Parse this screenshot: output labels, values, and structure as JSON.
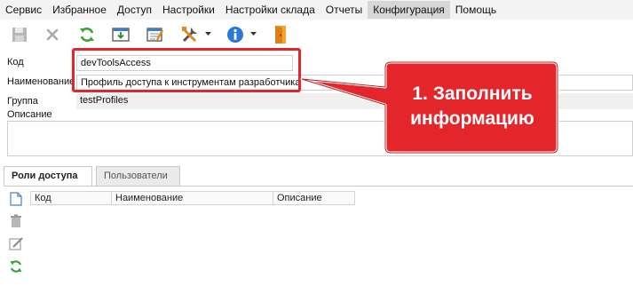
{
  "menu": [
    "Сервис",
    "Избранное",
    "Доступ",
    "Настройки",
    "Настройки склада",
    "Отчеты",
    "Конфигурация",
    "Помощь"
  ],
  "menu_active_index": 6,
  "toolbar": {
    "icons": [
      "save-icon",
      "delete-icon",
      "refresh-icon",
      "import-icon",
      "edit-table-icon",
      "tools-icon",
      "info-icon",
      "exit-icon"
    ]
  },
  "form": {
    "code_label": "Код",
    "code_value": "devToolsAccess",
    "name_label": "Наименование",
    "name_value": "Профиль доступа к инструментам разработчика",
    "group_label": "Группа",
    "group_value": "testProfiles",
    "description_label": "Описание",
    "description_value": ""
  },
  "callout": {
    "text_line1": "1. Заполнить",
    "text_line2": "информацию",
    "color": "#e3262b"
  },
  "tabs": [
    "Роли доступа",
    "Пользователи"
  ],
  "grid": {
    "columns": [
      "Код",
      "Наименование",
      "Описание"
    ]
  }
}
